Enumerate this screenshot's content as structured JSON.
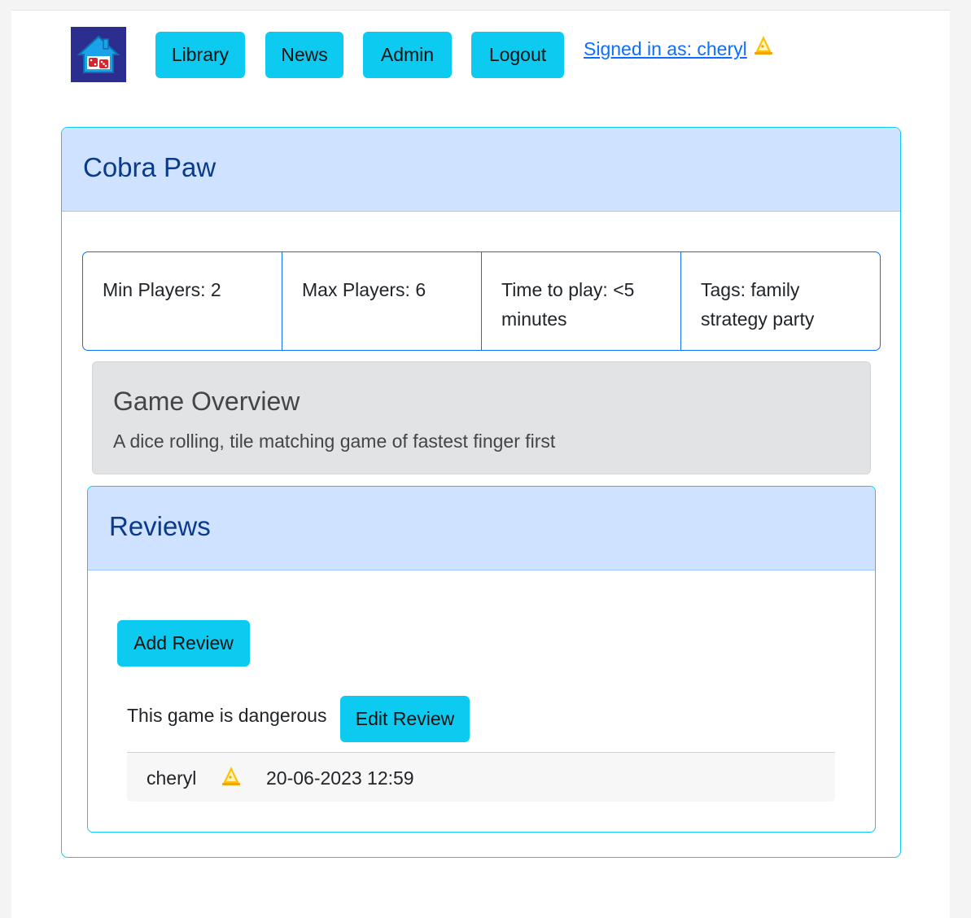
{
  "nav": {
    "logo_icon": "house-dice-logo-icon",
    "buttons": [
      {
        "label": "Library"
      },
      {
        "label": "News"
      },
      {
        "label": "Admin"
      },
      {
        "label": "Logout"
      }
    ],
    "signed_in_text": "Signed in as: cheryl",
    "user_badge_icon": "wizard-hat-icon",
    "accent_color": "#0dcaf0"
  },
  "game": {
    "title": "Cobra Paw",
    "stats": {
      "min_players": "Min Players: 2",
      "max_players": "Max Players: 6",
      "time_to_play": "Time to play: <5 minutes",
      "tags": "Tags: family strategy party"
    },
    "overview": {
      "title": "Game Overview",
      "description": "A dice rolling, tile matching game of fastest finger first"
    }
  },
  "reviews": {
    "title": "Reviews",
    "add_button_label": "Add Review",
    "items": [
      {
        "text": "This game is dangerous",
        "edit_button_label": "Edit Review",
        "author": "cheryl",
        "author_badge_icon": "wizard-hat-icon",
        "date": "20-06-2023 12:59"
      }
    ]
  }
}
